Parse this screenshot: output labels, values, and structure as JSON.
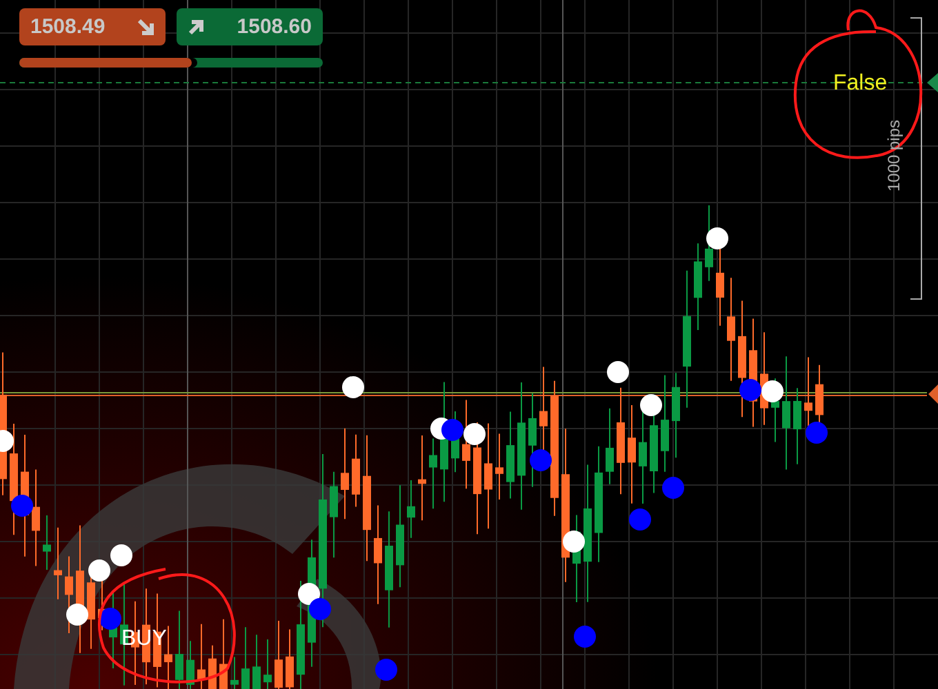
{
  "sell": {
    "price": "1508.49"
  },
  "buy": {
    "price": "1508.60"
  },
  "sentiment": {
    "level": 0.57
  },
  "signal_label": "False",
  "range_label": "1000 pips",
  "trade_label": "BUY"
}
